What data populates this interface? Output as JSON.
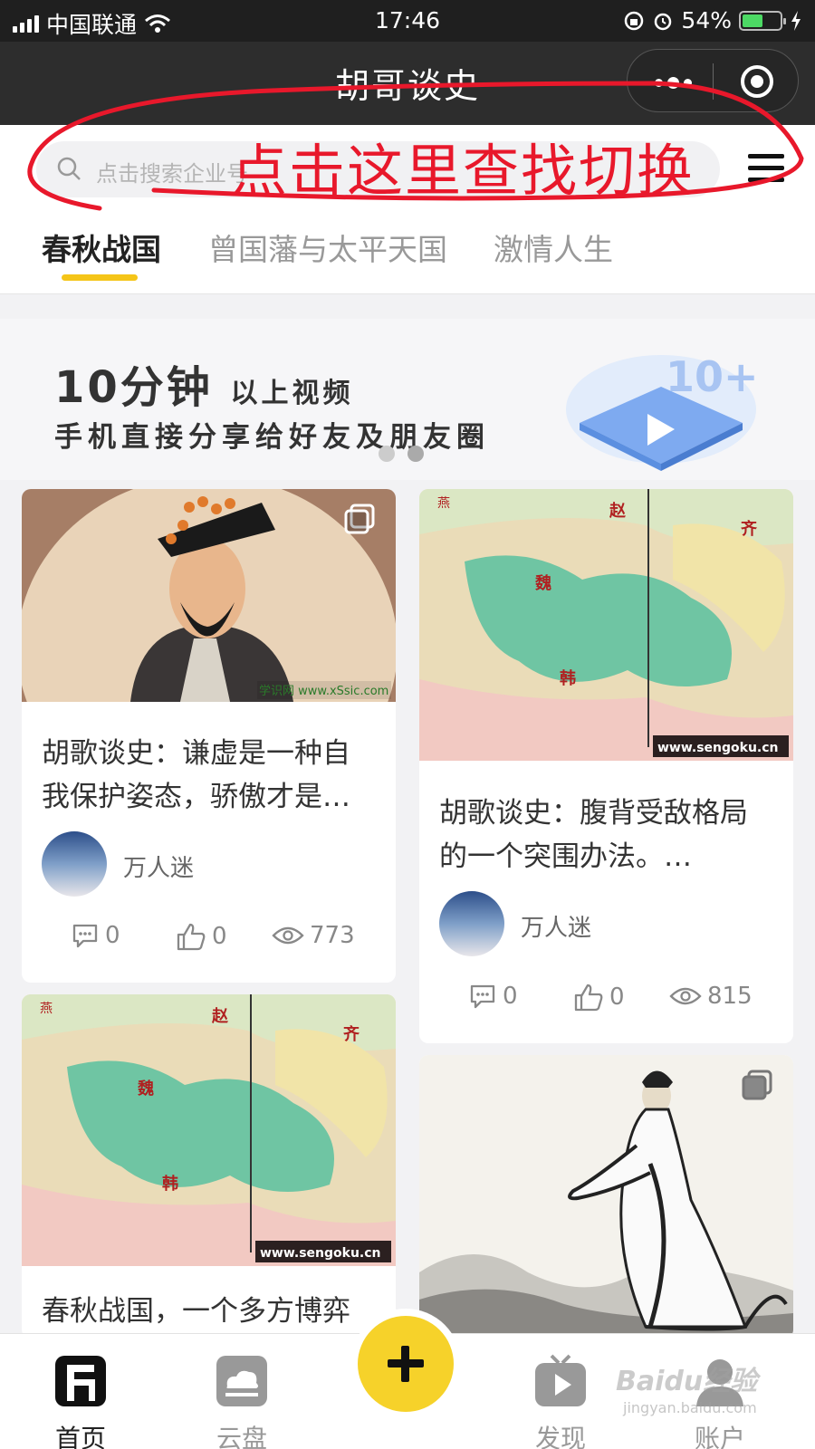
{
  "status_bar": {
    "carrier": "中国联通",
    "time": "17:46",
    "battery": "54%",
    "battery_level": 0.54
  },
  "nav": {
    "title": "胡哥谈史"
  },
  "search": {
    "placeholder": "点击搜索企业号"
  },
  "annotation": {
    "text": "点击这里查找切换",
    "color": "#e8182b"
  },
  "tabs": [
    {
      "label": "春秋战国",
      "active": true
    },
    {
      "label": "曾国藩与太平天国",
      "active": false
    },
    {
      "label": "激情人生",
      "active": false
    }
  ],
  "banner": {
    "title_big": "10分钟",
    "title_small": "以上视频",
    "subtitle": "手机直接分享给好友及朋友圈",
    "art_text": "10+"
  },
  "cards": [
    {
      "title": "胡歌谈史：谦虚是一种自我保护姿态，骄傲才是…",
      "author": "万人迷",
      "comments": "0",
      "likes": "0",
      "views": "773",
      "image_caption": "学识网 www.xSsic.com"
    },
    {
      "title": "胡歌谈史：腹背受敌格局的一个突围办法。…",
      "author": "万人迷",
      "comments": "0",
      "likes": "0",
      "views": "815",
      "image_caption": "www.sengoku.cn"
    },
    {
      "title": "春秋战国，一个多方博弈",
      "image_caption": "www.sengoku.cn"
    },
    {
      "title": ""
    }
  ],
  "map_labels": {
    "zhao": "赵",
    "wei": "魏",
    "han": "韩",
    "qi": "齐",
    "yan": "燕"
  },
  "bottom_nav": [
    {
      "label": "首页",
      "active": true
    },
    {
      "label": "云盘",
      "active": false
    },
    {
      "label": "发现",
      "active": false
    },
    {
      "label": "账户",
      "active": false
    }
  ],
  "watermark": {
    "main": "Baidu经验",
    "sub": "jingyan.baidu.com"
  },
  "colors": {
    "accent": "#f5c518",
    "plus": "#f6d22a",
    "annotation": "#e8182b",
    "nav_bg": "#2d2d2d"
  }
}
